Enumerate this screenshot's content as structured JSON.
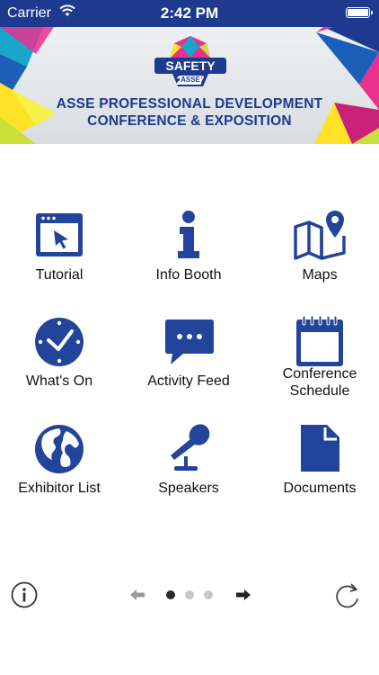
{
  "status_bar": {
    "carrier": "Carrier",
    "time": "2:42 PM"
  },
  "banner": {
    "badge_text": "SAFETY 2017",
    "badge_sub": "ASSE",
    "title_line1": "ASSE PROFESSIONAL DEVELOPMENT",
    "title_line2": "CONFERENCE & EXPOSITION"
  },
  "menu": {
    "items": [
      {
        "label": "Tutorial",
        "icon": "tutorial-icon"
      },
      {
        "label": "Info Booth",
        "icon": "info-icon"
      },
      {
        "label": "Maps",
        "icon": "map-icon"
      },
      {
        "label": "What's On",
        "icon": "clock-icon"
      },
      {
        "label": "Activity Feed",
        "icon": "chat-icon"
      },
      {
        "label": "Conference Schedule",
        "icon": "calendar-icon"
      },
      {
        "label": "Exhibitor List",
        "icon": "globe-icon"
      },
      {
        "label": "Speakers",
        "icon": "microphone-icon"
      },
      {
        "label": "Documents",
        "icon": "document-icon"
      }
    ]
  },
  "pager": {
    "page_count": 3,
    "current_page": 1
  },
  "colors": {
    "brand_blue": "#1d3a8f",
    "icon_blue": "#22449a"
  }
}
